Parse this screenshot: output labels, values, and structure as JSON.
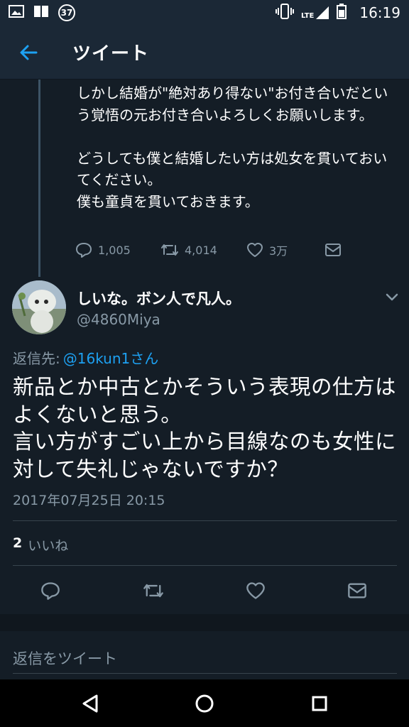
{
  "status_bar": {
    "notification_count": "37",
    "network": "LTE",
    "time": "16:19"
  },
  "header": {
    "title": "ツイート"
  },
  "previous_tweet": {
    "text": "しかし結婚が\"絶対あり得ない\"お付き合いだという覚悟の元お付き合いよろしくお願いします。\n\nどうしても僕と結婚したい方は処女を貫いておいてください。\n僕も童貞を貫いておきます。",
    "reply_count": "1,005",
    "retweet_count": "4,014",
    "like_count": "3万"
  },
  "tweet": {
    "display_name": "しいな。ボン人で凡人。",
    "handle": "@4860Miya",
    "reply_to_label": "返信先:",
    "reply_to_user": "@16kun1さん",
    "text": "新品とか中古とかそういう表現の仕方はよくないと思う。\n言い方がすごい上から目線なのも女性に対して失礼じゃないですか？",
    "timestamp": "2017年07月25日 20:15",
    "like_count": "2",
    "like_label": "いいね"
  },
  "reply_box": {
    "placeholder": "返信をツイート"
  },
  "colors": {
    "background": "#141d26",
    "header": "#1b2836",
    "accent": "#1da1f2",
    "secondary_text": "#8899a6"
  }
}
